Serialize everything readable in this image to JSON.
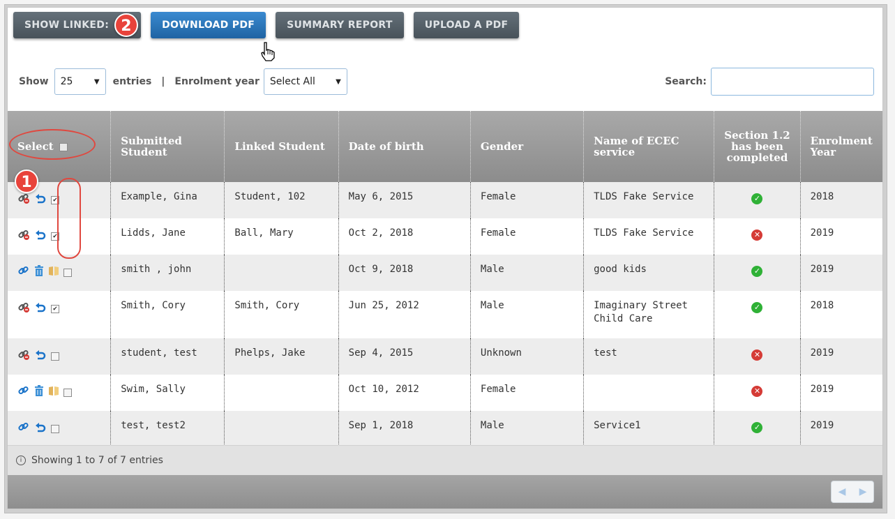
{
  "toolbar": {
    "show_linked": "SHOW LINKED:",
    "step2_badge": "2",
    "download_pdf": "DOWNLOAD PDF",
    "summary_report": "SUMMARY REPORT",
    "upload_pdf": "UPLOAD A PDF"
  },
  "filters": {
    "show_label": "Show",
    "entries_value": "25",
    "entries_label": "entries",
    "separator": "|",
    "enrolment_label": "Enrolment year",
    "enrolment_value": "Select All",
    "search_label": "Search:"
  },
  "table": {
    "headers": {
      "select": "Select",
      "submitted": "Submitted Student",
      "linked": "Linked Student",
      "dob": "Date of birth",
      "gender": "Gender",
      "service": "Name of ECEC service",
      "section": "Section 1.2 has been completed",
      "year": "Enrolment Year"
    },
    "step1_badge": "1",
    "rows": [
      {
        "submitted": "Example, Gina",
        "linked": "Student, 102",
        "dob": "May 6, 2015",
        "gender": "Female",
        "service": "TLDS Fake Service",
        "section_done": true,
        "year": "2018",
        "linked_state": true,
        "checked": true
      },
      {
        "submitted": "Lidds, Jane",
        "linked": "Ball, Mary",
        "dob": "Oct 2, 2018",
        "gender": "Female",
        "service": "TLDS Fake Service",
        "section_done": false,
        "year": "2019",
        "linked_state": true,
        "checked": true
      },
      {
        "submitted": "smith , john",
        "linked": "",
        "dob": "Oct 9, 2018",
        "gender": "Male",
        "service": "good kids",
        "section_done": true,
        "year": "2019",
        "linked_state": false,
        "checked": false
      },
      {
        "submitted": "Smith, Cory",
        "linked": "Smith, Cory",
        "dob": "Jun 25, 2012",
        "gender": "Male",
        "service": "Imaginary Street Child Care",
        "section_done": true,
        "year": "2018",
        "linked_state": true,
        "checked": true
      },
      {
        "submitted": "student, test",
        "linked": "Phelps, Jake",
        "dob": "Sep 4, 2015",
        "gender": "Unknown",
        "service": "test",
        "section_done": false,
        "year": "2019",
        "linked_state": true,
        "checked": false
      },
      {
        "submitted": "Swim, Sally",
        "linked": "",
        "dob": "Oct 10, 2012",
        "gender": "Female",
        "service": "",
        "section_done": false,
        "year": "2019",
        "linked_state": false,
        "checked": false
      },
      {
        "submitted": "test, test2",
        "linked": "",
        "dob": "Sep 1, 2018",
        "gender": "Male",
        "service": "Service1",
        "section_done": true,
        "year": "2019",
        "linked_state": "partial",
        "checked": false
      }
    ]
  },
  "info": {
    "text": "Showing 1 to 7 of 7 entries"
  },
  "colors": {
    "accent_blue": "#1f63a3",
    "annotation_red": "#e0483f",
    "ok_green": "#2fb136",
    "error_red": "#d53b36"
  }
}
